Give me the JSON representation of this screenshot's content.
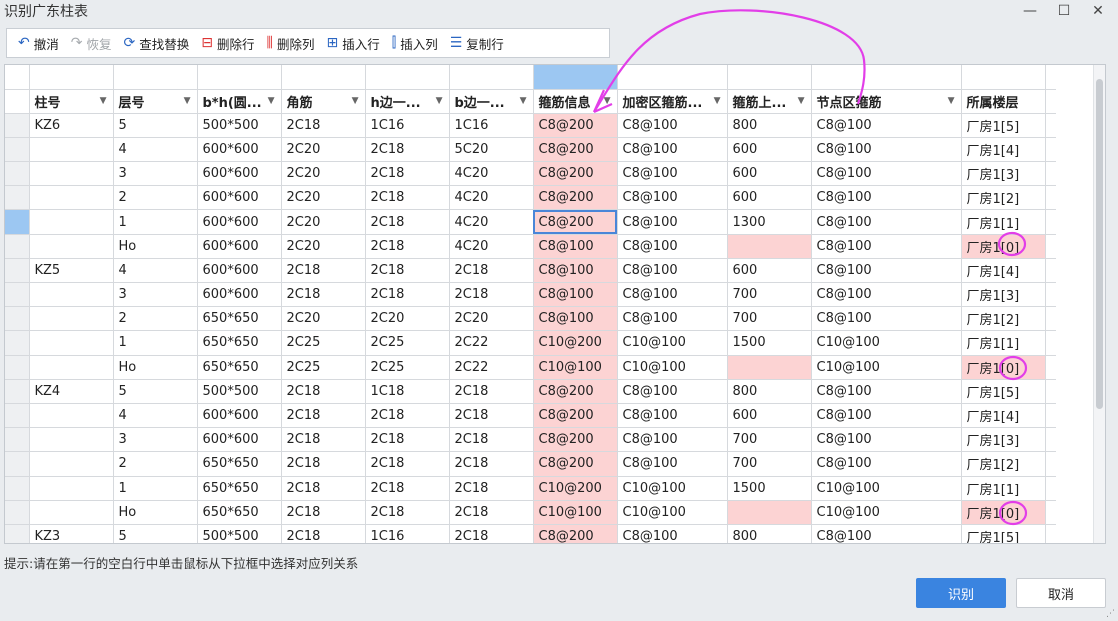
{
  "window": {
    "title": "识别广东柱表",
    "minimize": "—",
    "maximize": "☐",
    "close": "✕"
  },
  "toolbar": {
    "undo": "撤消",
    "redo": "恢复",
    "find_replace": "查找替换",
    "delete_row": "删除行",
    "delete_col": "删除列",
    "insert_row": "插入行",
    "insert_col": "插入列",
    "copy_row": "复制行"
  },
  "table": {
    "headers": [
      "柱号",
      "层号",
      "b*h(圆...",
      "角筋",
      "h边一...",
      "b边一...",
      "箍筋信息",
      "加密区箍筋...",
      "箍筋上...",
      "节点区箍筋",
      "所属楼层"
    ],
    "rows": [
      [
        "KZ6",
        "5",
        "500*500",
        "2C18",
        "1C16",
        "1C16",
        "C8@200",
        "C8@100",
        "800",
        "C8@100",
        "厂房1[5]"
      ],
      [
        "",
        "4",
        "600*600",
        "2C20",
        "2C18",
        "5C20",
        "C8@200",
        "C8@100",
        "600",
        "C8@100",
        "厂房1[4]"
      ],
      [
        "",
        "3",
        "600*600",
        "2C20",
        "2C18",
        "4C20",
        "C8@200",
        "C8@100",
        "600",
        "C8@100",
        "厂房1[3]"
      ],
      [
        "",
        "2",
        "600*600",
        "2C20",
        "2C18",
        "4C20",
        "C8@200",
        "C8@100",
        "600",
        "C8@100",
        "厂房1[2]"
      ],
      [
        "",
        "1",
        "600*600",
        "2C20",
        "2C18",
        "4C20",
        "C8@200",
        "C8@100",
        "1300",
        "C8@100",
        "厂房1[1]"
      ],
      [
        "",
        "Ho",
        "600*600",
        "2C20",
        "2C18",
        "4C20",
        "C8@100",
        "C8@100",
        "",
        "C8@100",
        "厂房1[0]"
      ],
      [
        "KZ5",
        "4",
        "600*600",
        "2C18",
        "2C18",
        "2C18",
        "C8@100",
        "C8@100",
        "600",
        "C8@100",
        "厂房1[4]"
      ],
      [
        "",
        "3",
        "600*600",
        "2C18",
        "2C18",
        "2C18",
        "C8@100",
        "C8@100",
        "700",
        "C8@100",
        "厂房1[3]"
      ],
      [
        "",
        "2",
        "650*650",
        "2C20",
        "2C20",
        "2C20",
        "C8@100",
        "C8@100",
        "700",
        "C8@100",
        "厂房1[2]"
      ],
      [
        "",
        "1",
        "650*650",
        "2C25",
        "2C25",
        "2C22",
        "C10@200",
        "C10@100",
        "1500",
        "C10@100",
        "厂房1[1]"
      ],
      [
        "",
        "Ho",
        "650*650",
        "2C25",
        "2C25",
        "2C22",
        "C10@100",
        "C10@100",
        "",
        "C10@100",
        "厂房1[0]"
      ],
      [
        "KZ4",
        "5",
        "500*500",
        "2C18",
        "1C18",
        "2C18",
        "C8@200",
        "C8@100",
        "800",
        "C8@100",
        "厂房1[5]"
      ],
      [
        "",
        "4",
        "600*600",
        "2C18",
        "2C18",
        "2C18",
        "C8@200",
        "C8@100",
        "600",
        "C8@100",
        "厂房1[4]"
      ],
      [
        "",
        "3",
        "600*600",
        "2C18",
        "2C18",
        "2C18",
        "C8@200",
        "C8@100",
        "700",
        "C8@100",
        "厂房1[3]"
      ],
      [
        "",
        "2",
        "650*650",
        "2C18",
        "2C18",
        "2C18",
        "C8@200",
        "C8@100",
        "700",
        "C8@100",
        "厂房1[2]"
      ],
      [
        "",
        "1",
        "650*650",
        "2C18",
        "2C18",
        "2C18",
        "C10@200",
        "C10@100",
        "1500",
        "C10@100",
        "厂房1[1]"
      ],
      [
        "",
        "Ho",
        "650*650",
        "2C18",
        "2C18",
        "2C18",
        "C10@100",
        "C10@100",
        "",
        "C10@100",
        "厂房1[0]"
      ],
      [
        "KZ3",
        "5",
        "500*500",
        "2C18",
        "1C16",
        "2C18",
        "C8@200",
        "C8@100",
        "800",
        "C8@100",
        "厂房1[5]"
      ]
    ]
  },
  "hint": "提示:请在第一行的空白行中单击鼠标从下拉框中选择对应列关系",
  "buttons": {
    "ok": "识别",
    "cancel": "取消"
  },
  "colors": {
    "highlight_pink": "#fcd3d3",
    "selected_blue": "#9cc7f2",
    "primary_button": "#3a84e0",
    "annotation_magenta": "#e23ee8"
  }
}
